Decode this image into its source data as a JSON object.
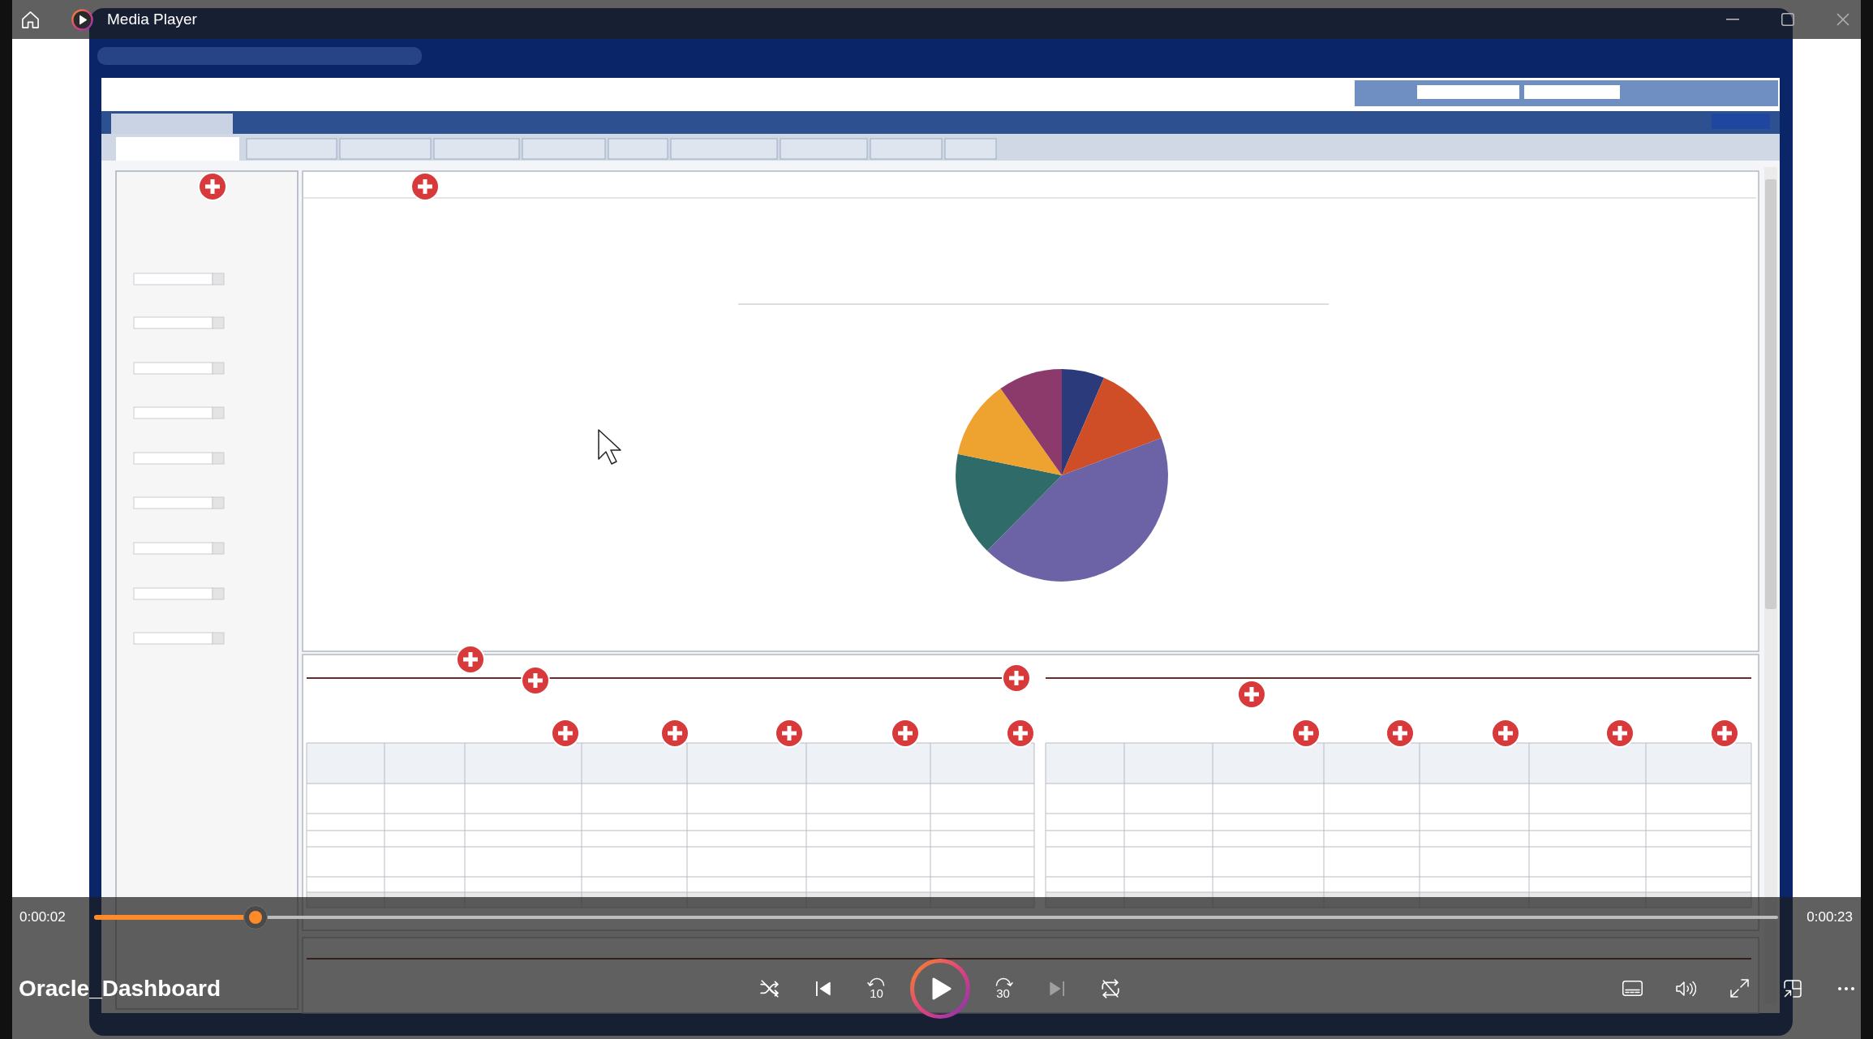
{
  "window": {
    "title": "Media Player"
  },
  "player": {
    "time_elapsed": "0:00:02",
    "progress": {
      "level": 0.096
    },
    "time_total": "0:00:23",
    "media_title": "Oracle_Dashboard",
    "transport": {
      "shuffle": {
        "on": false
      },
      "previous": {
        "disabled": false
      },
      "rewind": {
        "label": "10"
      },
      "play": {
        "playing": false
      },
      "forward": {
        "label": "30"
      },
      "next": {
        "disabled": true
      },
      "repeat": {
        "on": false
      }
    }
  }
}
